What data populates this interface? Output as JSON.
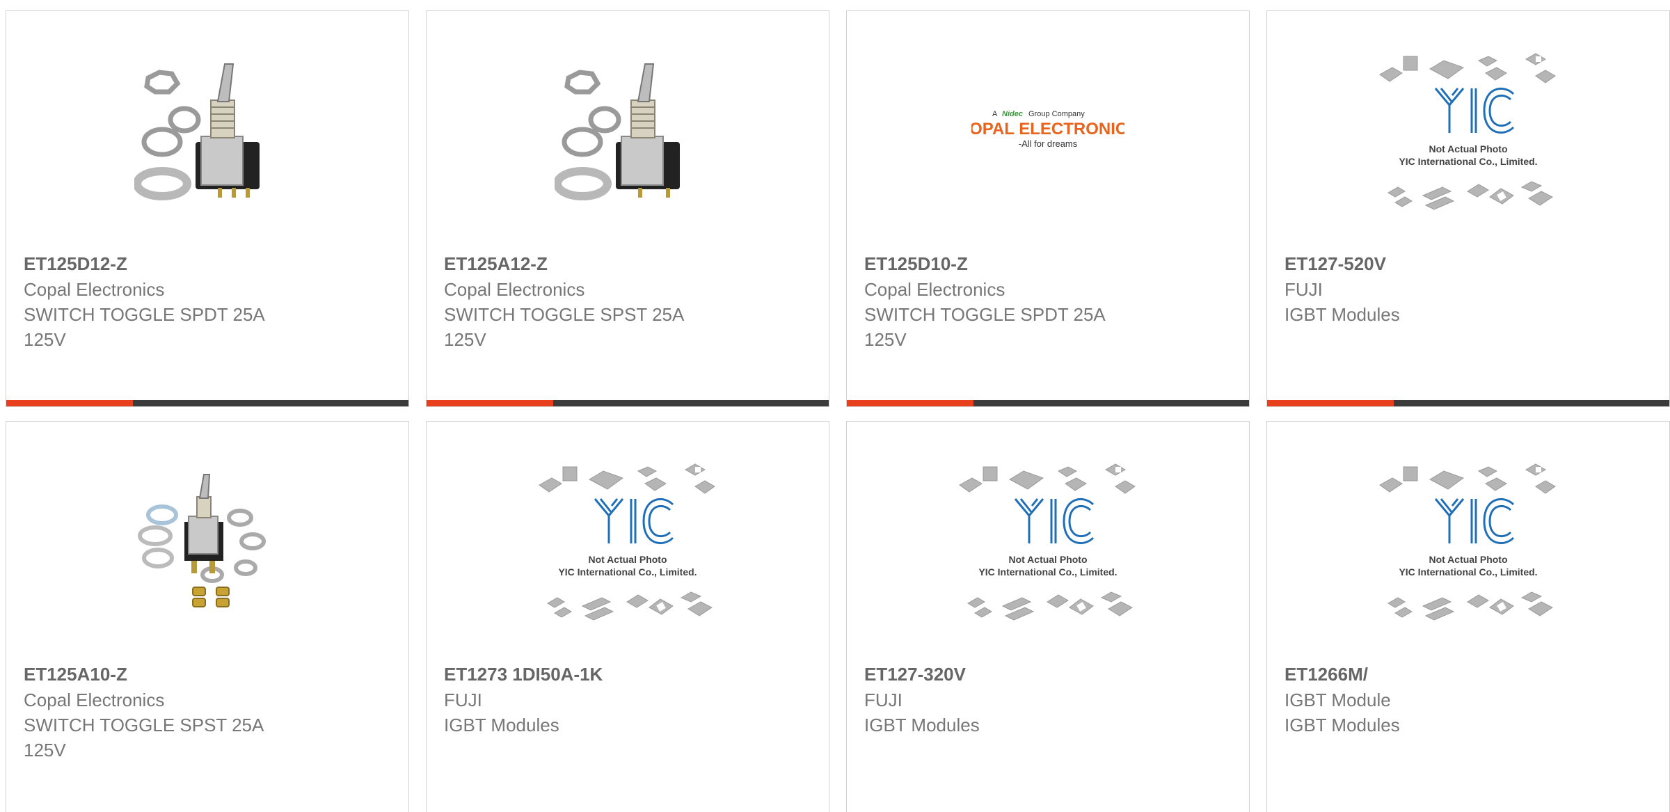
{
  "colors": {
    "accent": "#e8401c",
    "bar_dark": "#3b3b3b",
    "card_border": "#d2d2d2",
    "text_gray": "#777777",
    "yic_blue": "#1e6fb8",
    "copal_orange": "#e8641c",
    "copal_green": "#3a9a3a"
  },
  "products": [
    {
      "part_number": "ET125D12-Z",
      "lines": [
        "Copal Electronics",
        "SWITCH TOGGLE SPDT 25A",
        "125V"
      ],
      "image": "toggle-switch-photo"
    },
    {
      "part_number": "ET125A12-Z",
      "lines": [
        "Copal Electronics",
        "SWITCH TOGGLE SPST 25A",
        "125V"
      ],
      "image": "toggle-switch-photo"
    },
    {
      "part_number": "ET125D10-Z",
      "lines": [
        "Copal Electronics",
        "SWITCH TOGGLE SPDT 25A",
        "125V"
      ],
      "image": "copal-logo"
    },
    {
      "part_number": "ET127-520V",
      "lines": [
        "FUJI",
        "IGBT Modules"
      ],
      "image": "yic-placeholder"
    },
    {
      "part_number": "ET125A10-Z",
      "lines": [
        "Copal Electronics",
        "SWITCH TOGGLE SPST 25A",
        "125V"
      ],
      "image": "toggle-switch-kit-photo"
    },
    {
      "part_number": "ET1273 1DI50A-1K",
      "lines": [
        "FUJI",
        "IGBT Modules"
      ],
      "image": "yic-placeholder"
    },
    {
      "part_number": "ET127-320V",
      "lines": [
        "FUJI",
        "IGBT Modules"
      ],
      "image": "yic-placeholder"
    },
    {
      "part_number": "ET1266M/",
      "lines": [
        "IGBT Module",
        "IGBT Modules"
      ],
      "image": "yic-placeholder"
    }
  ],
  "images": {
    "copal_logo": {
      "tagline_prefix": "A",
      "tagline_brand": "Nidec",
      "tagline_suffix": "Group Company",
      "name": "COPAL ELECTRONICS",
      "slogan": "-All for dreams"
    },
    "yic_placeholder": {
      "mark": "YIC",
      "line1": "Not Actual Photo",
      "line2": "YIC International Co., Limited."
    }
  }
}
